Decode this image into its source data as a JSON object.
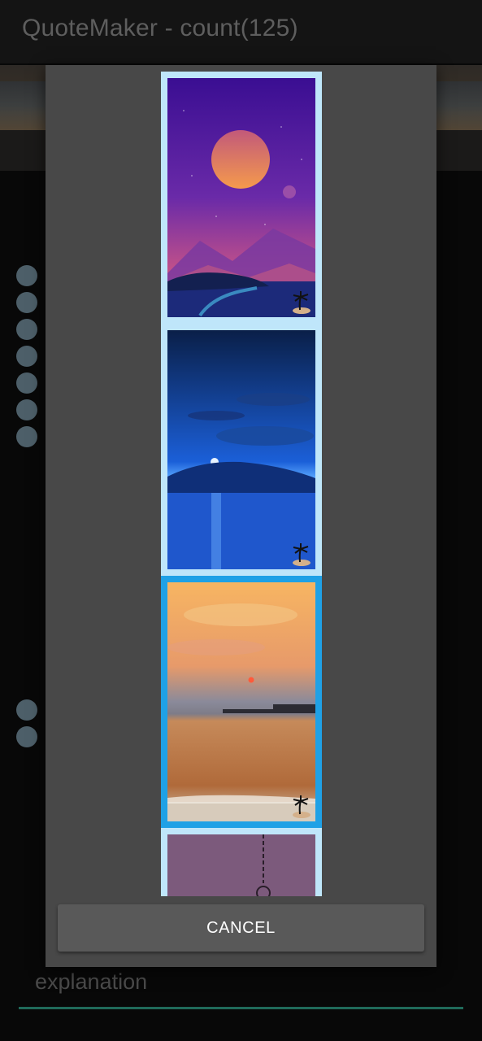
{
  "app": {
    "title": "QuoteMaker - count(125)"
  },
  "form": {
    "explanation_placeholder": "explanation"
  },
  "dialog": {
    "images": [
      {
        "name": "purple-moon-mountains",
        "selected": false
      },
      {
        "name": "blue-moonlit-island",
        "selected": false
      },
      {
        "name": "orange-sunset-pier",
        "selected": true
      },
      {
        "name": "mauve-hanging-chain",
        "selected": false
      }
    ],
    "watermark_icon": "palm-island-icon",
    "cancel_label": "CANCEL"
  },
  "colors": {
    "selected_border": "#1fa1e6",
    "thumb_border": "#bfe6fa",
    "dialog_bg": "#484848"
  }
}
